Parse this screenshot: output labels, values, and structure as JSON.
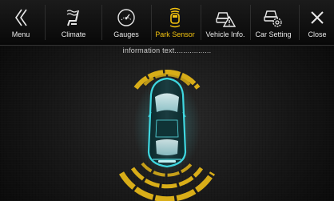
{
  "toolbar": {
    "items": [
      {
        "label": "Menu",
        "icon": "chevron-double-left-icon"
      },
      {
        "label": "Climate",
        "icon": "climate-seat-icon"
      },
      {
        "label": "Gauges",
        "icon": "gauge-icon"
      },
      {
        "label": "Park Sensor",
        "icon": "park-sensor-icon",
        "active": true
      },
      {
        "label": "Vehicle Info.",
        "icon": "vehicle-info-icon"
      },
      {
        "label": "Car Setting",
        "icon": "car-setting-icon"
      },
      {
        "label": "Close",
        "icon": "close-icon"
      }
    ]
  },
  "info_text": "information text.................",
  "colors": {
    "active": "#f2c20f",
    "sensor_arc": "#d8ad18",
    "car_glow": "#3fd7e0"
  }
}
